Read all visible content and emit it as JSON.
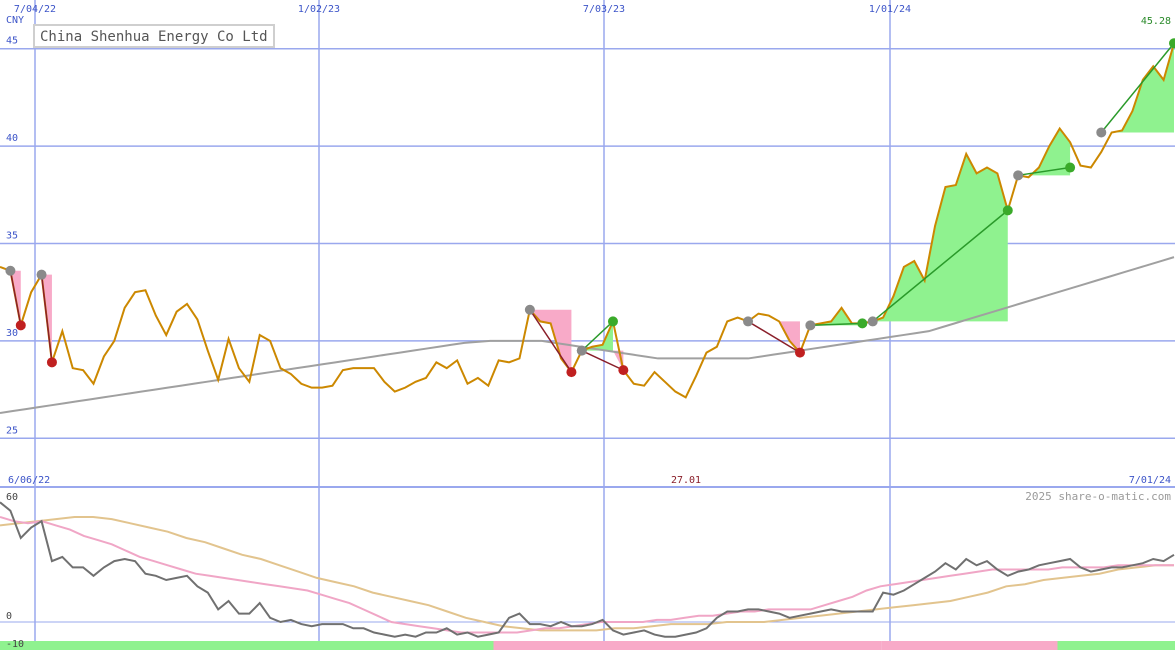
{
  "title": "China Shenhua Energy Co Ltd",
  "currency": "CNY",
  "copyright": "2025 share-o-matic.com",
  "colors": {
    "price": "#cc8800",
    "ma_long": "#a0a0a0",
    "grid": "#9aa8ee",
    "axis_text": "#3c54c8",
    "up_fill": "#8ff28f",
    "down_fill": "#f8aac8",
    "up_line": "#2a9a2a",
    "down_line": "#8a1f2a",
    "osc_main": "#707070",
    "osc_pink": "#f0a6c6",
    "osc_tan": "#e2c48e"
  },
  "chart_data": [
    {
      "type": "line",
      "title": "China Shenhua Energy Co Ltd",
      "ylabel": "CNY",
      "ylim": [
        22.5,
        47.5
      ],
      "yticks": [
        25,
        30,
        35,
        40,
        45
      ],
      "x_tick_labels": [
        "7/04/22",
        "1/02/23",
        "7/03/23",
        "1/01/24"
      ],
      "last_value_label": "45.28",
      "grid": true,
      "series": [
        {
          "role": "price",
          "values": [
            33.8,
            33.6,
            30.8,
            32.5,
            33.4,
            28.9,
            30.5,
            28.6,
            28.5,
            27.8,
            29.2,
            30.0,
            31.7,
            32.5,
            32.6,
            31.3,
            30.3,
            31.5,
            31.9,
            31.1,
            29.5,
            28.0,
            30.1,
            28.6,
            27.9,
            30.3,
            30.0,
            28.6,
            28.3,
            27.8,
            27.6,
            27.6,
            27.7,
            28.5,
            28.6,
            28.6,
            28.6,
            27.9,
            27.4,
            27.6,
            27.9,
            28.1,
            28.9,
            28.6,
            29.0,
            27.8,
            28.1,
            27.7,
            29.0,
            28.9,
            29.1,
            31.6,
            31.0,
            30.9,
            29.1,
            28.4,
            29.5,
            29.7,
            29.8,
            31.0,
            28.5,
            27.8,
            27.7,
            28.4,
            27.9,
            27.4,
            27.1,
            28.2,
            29.4,
            29.7,
            31.0,
            31.2,
            31.0,
            31.4,
            31.3,
            31.0,
            30.0,
            29.4,
            30.8,
            30.9,
            31.0,
            31.7,
            30.9,
            30.9,
            31.0,
            31.2,
            32.3,
            33.8,
            34.1,
            33.1,
            35.9,
            37.9,
            38.0,
            39.6,
            38.6,
            38.9,
            38.6,
            36.7,
            38.5,
            38.4,
            38.9,
            40.0,
            40.9,
            40.2,
            39.0,
            38.9,
            39.7,
            40.7,
            40.8,
            41.8,
            43.4,
            44.1,
            43.4,
            45.28
          ]
        },
        {
          "role": "long moving average",
          "values": [
            26.3,
            26.4,
            26.5,
            26.6,
            26.7,
            26.8,
            26.9,
            27.0,
            27.1,
            27.2,
            27.3,
            27.4,
            27.5,
            27.6,
            27.7,
            27.8,
            27.9,
            28.0,
            28.1,
            28.2,
            28.3,
            28.4,
            28.5,
            28.6,
            28.7,
            28.8,
            28.9,
            29.0,
            29.1,
            29.2,
            29.3,
            29.4,
            29.5,
            29.6,
            29.7,
            29.8,
            29.9,
            29.95,
            30.0,
            30.0,
            30.0,
            30.0,
            30.0,
            29.9,
            29.8,
            29.7,
            29.6,
            29.5,
            29.4,
            29.3,
            29.2,
            29.1,
            29.1,
            29.1,
            29.1,
            29.1,
            29.1,
            29.1,
            29.1,
            29.2,
            29.3,
            29.4,
            29.5,
            29.6,
            29.7,
            29.8,
            29.9,
            30.0,
            30.1,
            30.2,
            30.3,
            30.4,
            30.5,
            30.7,
            30.9,
            31.1,
            31.3,
            31.5,
            31.7,
            31.9,
            32.1,
            32.3,
            32.5,
            32.7,
            32.9,
            33.1,
            33.3,
            33.5,
            33.7,
            33.9,
            34.1,
            34.3
          ]
        }
      ],
      "annotations": [
        {
          "kind": "down",
          "from": [
            1,
            33.6
          ],
          "to": [
            2,
            30.8
          ]
        },
        {
          "kind": "down",
          "from": [
            4,
            33.4
          ],
          "to": [
            5,
            28.9
          ]
        },
        {
          "kind": "down",
          "from": [
            51,
            31.6
          ],
          "to": [
            55,
            28.4
          ]
        },
        {
          "kind": "down",
          "from": [
            56,
            29.5
          ],
          "to": [
            60,
            28.5
          ]
        },
        {
          "kind": "up",
          "from": [
            56,
            29.5
          ],
          "to": [
            59,
            31.0
          ]
        },
        {
          "kind": "down",
          "from": [
            72,
            31.0
          ],
          "to": [
            77,
            29.4
          ]
        },
        {
          "kind": "up",
          "from": [
            78,
            30.8
          ],
          "to": [
            83,
            30.9
          ]
        },
        {
          "kind": "up",
          "from": [
            84,
            31.0
          ],
          "to": [
            97,
            36.7
          ]
        },
        {
          "kind": "up",
          "from": [
            98,
            38.5
          ],
          "to": [
            103,
            38.9
          ]
        },
        {
          "kind": "up",
          "from": [
            106,
            40.7
          ],
          "to": [
            113,
            45.28
          ]
        }
      ]
    },
    {
      "type": "line",
      "title": "",
      "ylim": [
        -10,
        60
      ],
      "yticks": [
        60,
        0,
        -10
      ],
      "x_tick_labels": [
        "6/06/22",
        "7/01/24"
      ],
      "center_label": "27.01",
      "grid": true,
      "series": [
        {
          "role": "oscillator",
          "values": [
            57,
            53,
            40,
            45,
            48,
            29,
            31,
            26,
            26,
            22,
            26,
            29,
            30,
            29,
            23,
            22,
            20,
            21,
            22,
            17,
            14,
            6,
            10,
            4,
            4,
            9,
            2,
            0,
            1,
            -1,
            -2,
            -1,
            -1,
            -1,
            -3,
            -3,
            -5,
            -6,
            -7,
            -6,
            -7,
            -5,
            -5,
            -3,
            -6,
            -5,
            -7,
            -6,
            -5,
            2,
            4,
            -1,
            -1,
            -2,
            0,
            -2,
            -2,
            -1,
            1,
            -4,
            -6,
            -5,
            -4,
            -6,
            -7,
            -7,
            -6,
            -5,
            -3,
            2,
            5,
            5,
            6,
            6,
            5,
            4,
            2,
            3,
            4,
            5,
            6,
            5,
            5,
            5,
            5,
            14,
            13,
            15,
            18,
            21,
            24,
            28,
            25,
            30,
            27,
            29,
            25,
            22,
            24,
            25,
            27,
            28,
            29,
            30,
            26,
            24,
            25,
            26,
            26,
            27,
            28,
            30,
            29,
            32
          ]
        },
        {
          "role": "signal average",
          "values": [
            50,
            48,
            47,
            48,
            46,
            44,
            41,
            39,
            37,
            34,
            31,
            29,
            27,
            25,
            23,
            22,
            21,
            20,
            19,
            18,
            17,
            16,
            15,
            13,
            11,
            9,
            6,
            3,
            0,
            -1,
            -2,
            -3,
            -4,
            -5,
            -5,
            -5,
            -5,
            -5,
            -4,
            -3,
            -3,
            -2,
            -1,
            0,
            0,
            0,
            0,
            1,
            1,
            2,
            3,
            3,
            4,
            5,
            5,
            6,
            6,
            6,
            6,
            8,
            10,
            12,
            15,
            17,
            18,
            19,
            20,
            21,
            22,
            23,
            24,
            25,
            25,
            25,
            25,
            25,
            26,
            26,
            26,
            26,
            27,
            27,
            27,
            27,
            27
          ]
        },
        {
          "role": "slow average",
          "values": [
            46,
            47,
            48,
            49,
            50,
            50,
            49,
            47,
            45,
            43,
            40,
            38,
            35,
            32,
            30,
            27,
            24,
            21,
            19,
            17,
            14,
            12,
            10,
            8,
            5,
            2,
            0,
            -2,
            -3,
            -4,
            -4,
            -4,
            -4,
            -3,
            -3,
            -2,
            -1,
            -1,
            -1,
            0,
            0,
            0,
            1,
            2,
            3,
            4,
            5,
            6,
            7,
            8,
            9,
            10,
            12,
            14,
            17,
            18,
            20,
            21,
            22,
            23,
            25,
            26,
            27,
            27
          ]
        }
      ],
      "histogram": [
        {
          "from": 0,
          "to": 0.42,
          "sign": "up"
        },
        {
          "from": 0.42,
          "to": 0.75,
          "sign": "down"
        },
        {
          "from": 0.75,
          "to": 0.9,
          "sign": "down"
        },
        {
          "from": 0.9,
          "to": 1.0,
          "sign": "up"
        }
      ]
    }
  ]
}
